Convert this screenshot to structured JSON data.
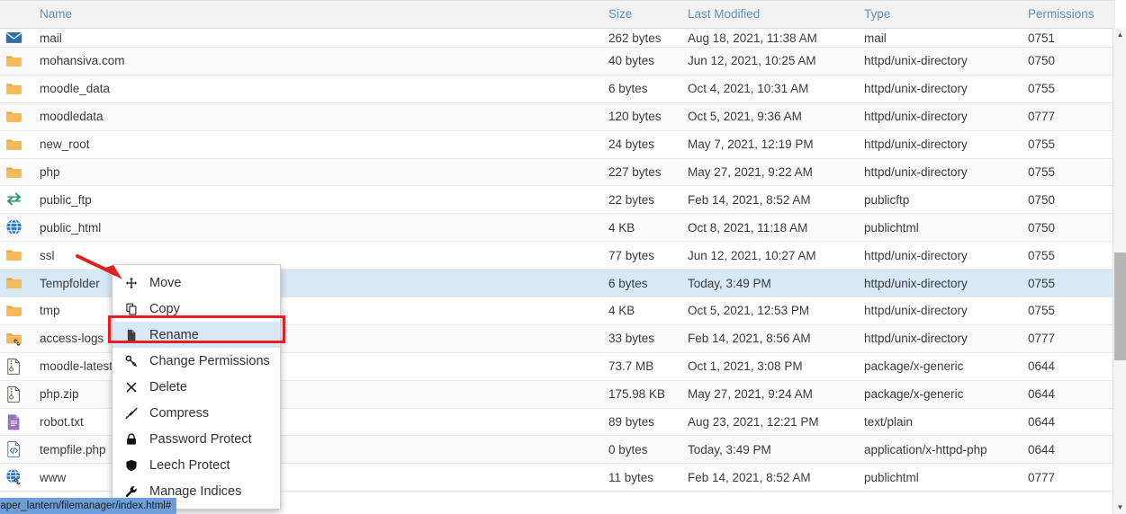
{
  "table": {
    "columns": [
      {
        "key": "icon",
        "label": ""
      },
      {
        "key": "name",
        "label": "Name"
      },
      {
        "key": "size",
        "label": "Size"
      },
      {
        "key": "modified",
        "label": "Last Modified"
      },
      {
        "key": "type",
        "label": "Type"
      },
      {
        "key": "permissions",
        "label": "Permissions"
      }
    ],
    "rows": [
      {
        "icon": "mail-icon",
        "name": "mail",
        "size": "262 bytes",
        "modified": "Aug 18, 2021, 11:38 AM",
        "type": "mail",
        "permissions": "0751",
        "clipped": true
      },
      {
        "icon": "folder-icon",
        "name": "mohansiva.com",
        "size": "40 bytes",
        "modified": "Jun 12, 2021, 10:25 AM",
        "type": "httpd/unix-directory",
        "permissions": "0750"
      },
      {
        "icon": "folder-icon",
        "name": "moodle_data",
        "size": "6 bytes",
        "modified": "Oct 4, 2021, 10:31 AM",
        "type": "httpd/unix-directory",
        "permissions": "0755"
      },
      {
        "icon": "folder-icon",
        "name": "moodledata",
        "size": "120 bytes",
        "modified": "Oct 5, 2021, 9:36 AM",
        "type": "httpd/unix-directory",
        "permissions": "0777"
      },
      {
        "icon": "folder-icon",
        "name": "new_root",
        "size": "24 bytes",
        "modified": "May 7, 2021, 12:19 PM",
        "type": "httpd/unix-directory",
        "permissions": "0755"
      },
      {
        "icon": "folder-icon",
        "name": "php",
        "size": "227 bytes",
        "modified": "May 27, 2021, 9:22 AM",
        "type": "httpd/unix-directory",
        "permissions": "0755"
      },
      {
        "icon": "ftp-icon",
        "name": "public_ftp",
        "size": "22 bytes",
        "modified": "Feb 14, 2021, 8:52 AM",
        "type": "publicftp",
        "permissions": "0750"
      },
      {
        "icon": "globe-icon",
        "name": "public_html",
        "size": "4 KB",
        "modified": "Oct 8, 2021, 11:18 AM",
        "type": "publichtml",
        "permissions": "0750"
      },
      {
        "icon": "folder-icon",
        "name": "ssl",
        "size": "77 bytes",
        "modified": "Jun 12, 2021, 10:27 AM",
        "type": "httpd/unix-directory",
        "permissions": "0755"
      },
      {
        "icon": "folder-icon",
        "name": "Tempfolder",
        "size": "6 bytes",
        "modified": "Today, 3:49 PM",
        "type": "httpd/unix-directory",
        "permissions": "0755",
        "selected": true
      },
      {
        "icon": "folder-icon",
        "name": "tmp",
        "size": "4 KB",
        "modified": "Oct 5, 2021, 12:53 PM",
        "type": "httpd/unix-directory",
        "permissions": "0755"
      },
      {
        "icon": "folder-link-icon",
        "name": "access-logs",
        "size": "33 bytes",
        "modified": "Feb 14, 2021, 8:56 AM",
        "type": "httpd/unix-directory",
        "permissions": "0777"
      },
      {
        "icon": "archive-icon",
        "name": "moodle-latest",
        "size": "73.7 MB",
        "modified": "Oct 1, 2021, 3:08 PM",
        "type": "package/x-generic",
        "permissions": "0644"
      },
      {
        "icon": "archive-icon",
        "name": "php.zip",
        "size": "175.98 KB",
        "modified": "May 27, 2021, 9:24 AM",
        "type": "package/x-generic",
        "permissions": "0644"
      },
      {
        "icon": "text-file-icon",
        "name": "robot.txt",
        "size": "89 bytes",
        "modified": "Aug 23, 2021, 12:21 PM",
        "type": "text/plain",
        "permissions": "0644"
      },
      {
        "icon": "code-file-icon",
        "name": "tempfile.php",
        "size": "0 bytes",
        "modified": "Today, 3:49 PM",
        "type": "application/x-httpd-php",
        "permissions": "0644"
      },
      {
        "icon": "globe-link-icon",
        "name": "www",
        "size": "11 bytes",
        "modified": "Feb 14, 2021, 8:52 AM",
        "type": "publichtml",
        "permissions": "0777"
      }
    ]
  },
  "context_menu": {
    "items": [
      {
        "label": "Move",
        "icon": "move-icon",
        "active": false
      },
      {
        "label": "Copy",
        "icon": "copy-icon",
        "active": false
      },
      {
        "label": "Rename",
        "icon": "rename-icon",
        "active": true
      },
      {
        "label": "Change Permissions",
        "icon": "key-icon",
        "active": false
      },
      {
        "label": "Delete",
        "icon": "delete-icon",
        "active": false
      },
      {
        "label": "Compress",
        "icon": "compress-icon",
        "active": false
      },
      {
        "label": "Password Protect",
        "icon": "lock-icon",
        "active": false
      },
      {
        "label": "Leech Protect",
        "icon": "shield-icon",
        "active": false
      },
      {
        "label": "Manage Indices",
        "icon": "wrench-icon",
        "active": false
      }
    ]
  },
  "status_bar": {
    "text": "paper_lantern/filemanager/index.html#"
  },
  "annotations": {
    "highlight_color": "#e81e25",
    "arrow_color": "#e02020",
    "selected_row_color": "#d7e9f7",
    "header_text_color": "#5f91ba"
  },
  "scrollbar": {
    "up_arrow": "▲",
    "down_arrow": "▼"
  }
}
